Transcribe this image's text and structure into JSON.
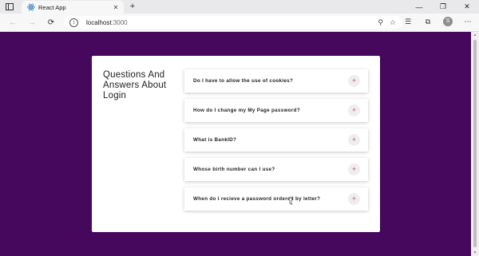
{
  "browser": {
    "tab_title": "React App",
    "url_host": "localhost",
    "url_port": ":3000",
    "profile_initial": "S"
  },
  "faq": {
    "heading": "Questions And Answers About Login",
    "items": [
      {
        "question": "Do I have to allow the use of cookies?"
      },
      {
        "question": "How do I change my My Page password?"
      },
      {
        "question": "What is BankID?"
      },
      {
        "question": "Whose birth number can I use?"
      },
      {
        "question": "When do I recieve a password ordered by letter?"
      }
    ],
    "toggle_symbol": "+"
  },
  "colors": {
    "page_background": "#45085c",
    "toggle_accent": "#c9527a"
  }
}
